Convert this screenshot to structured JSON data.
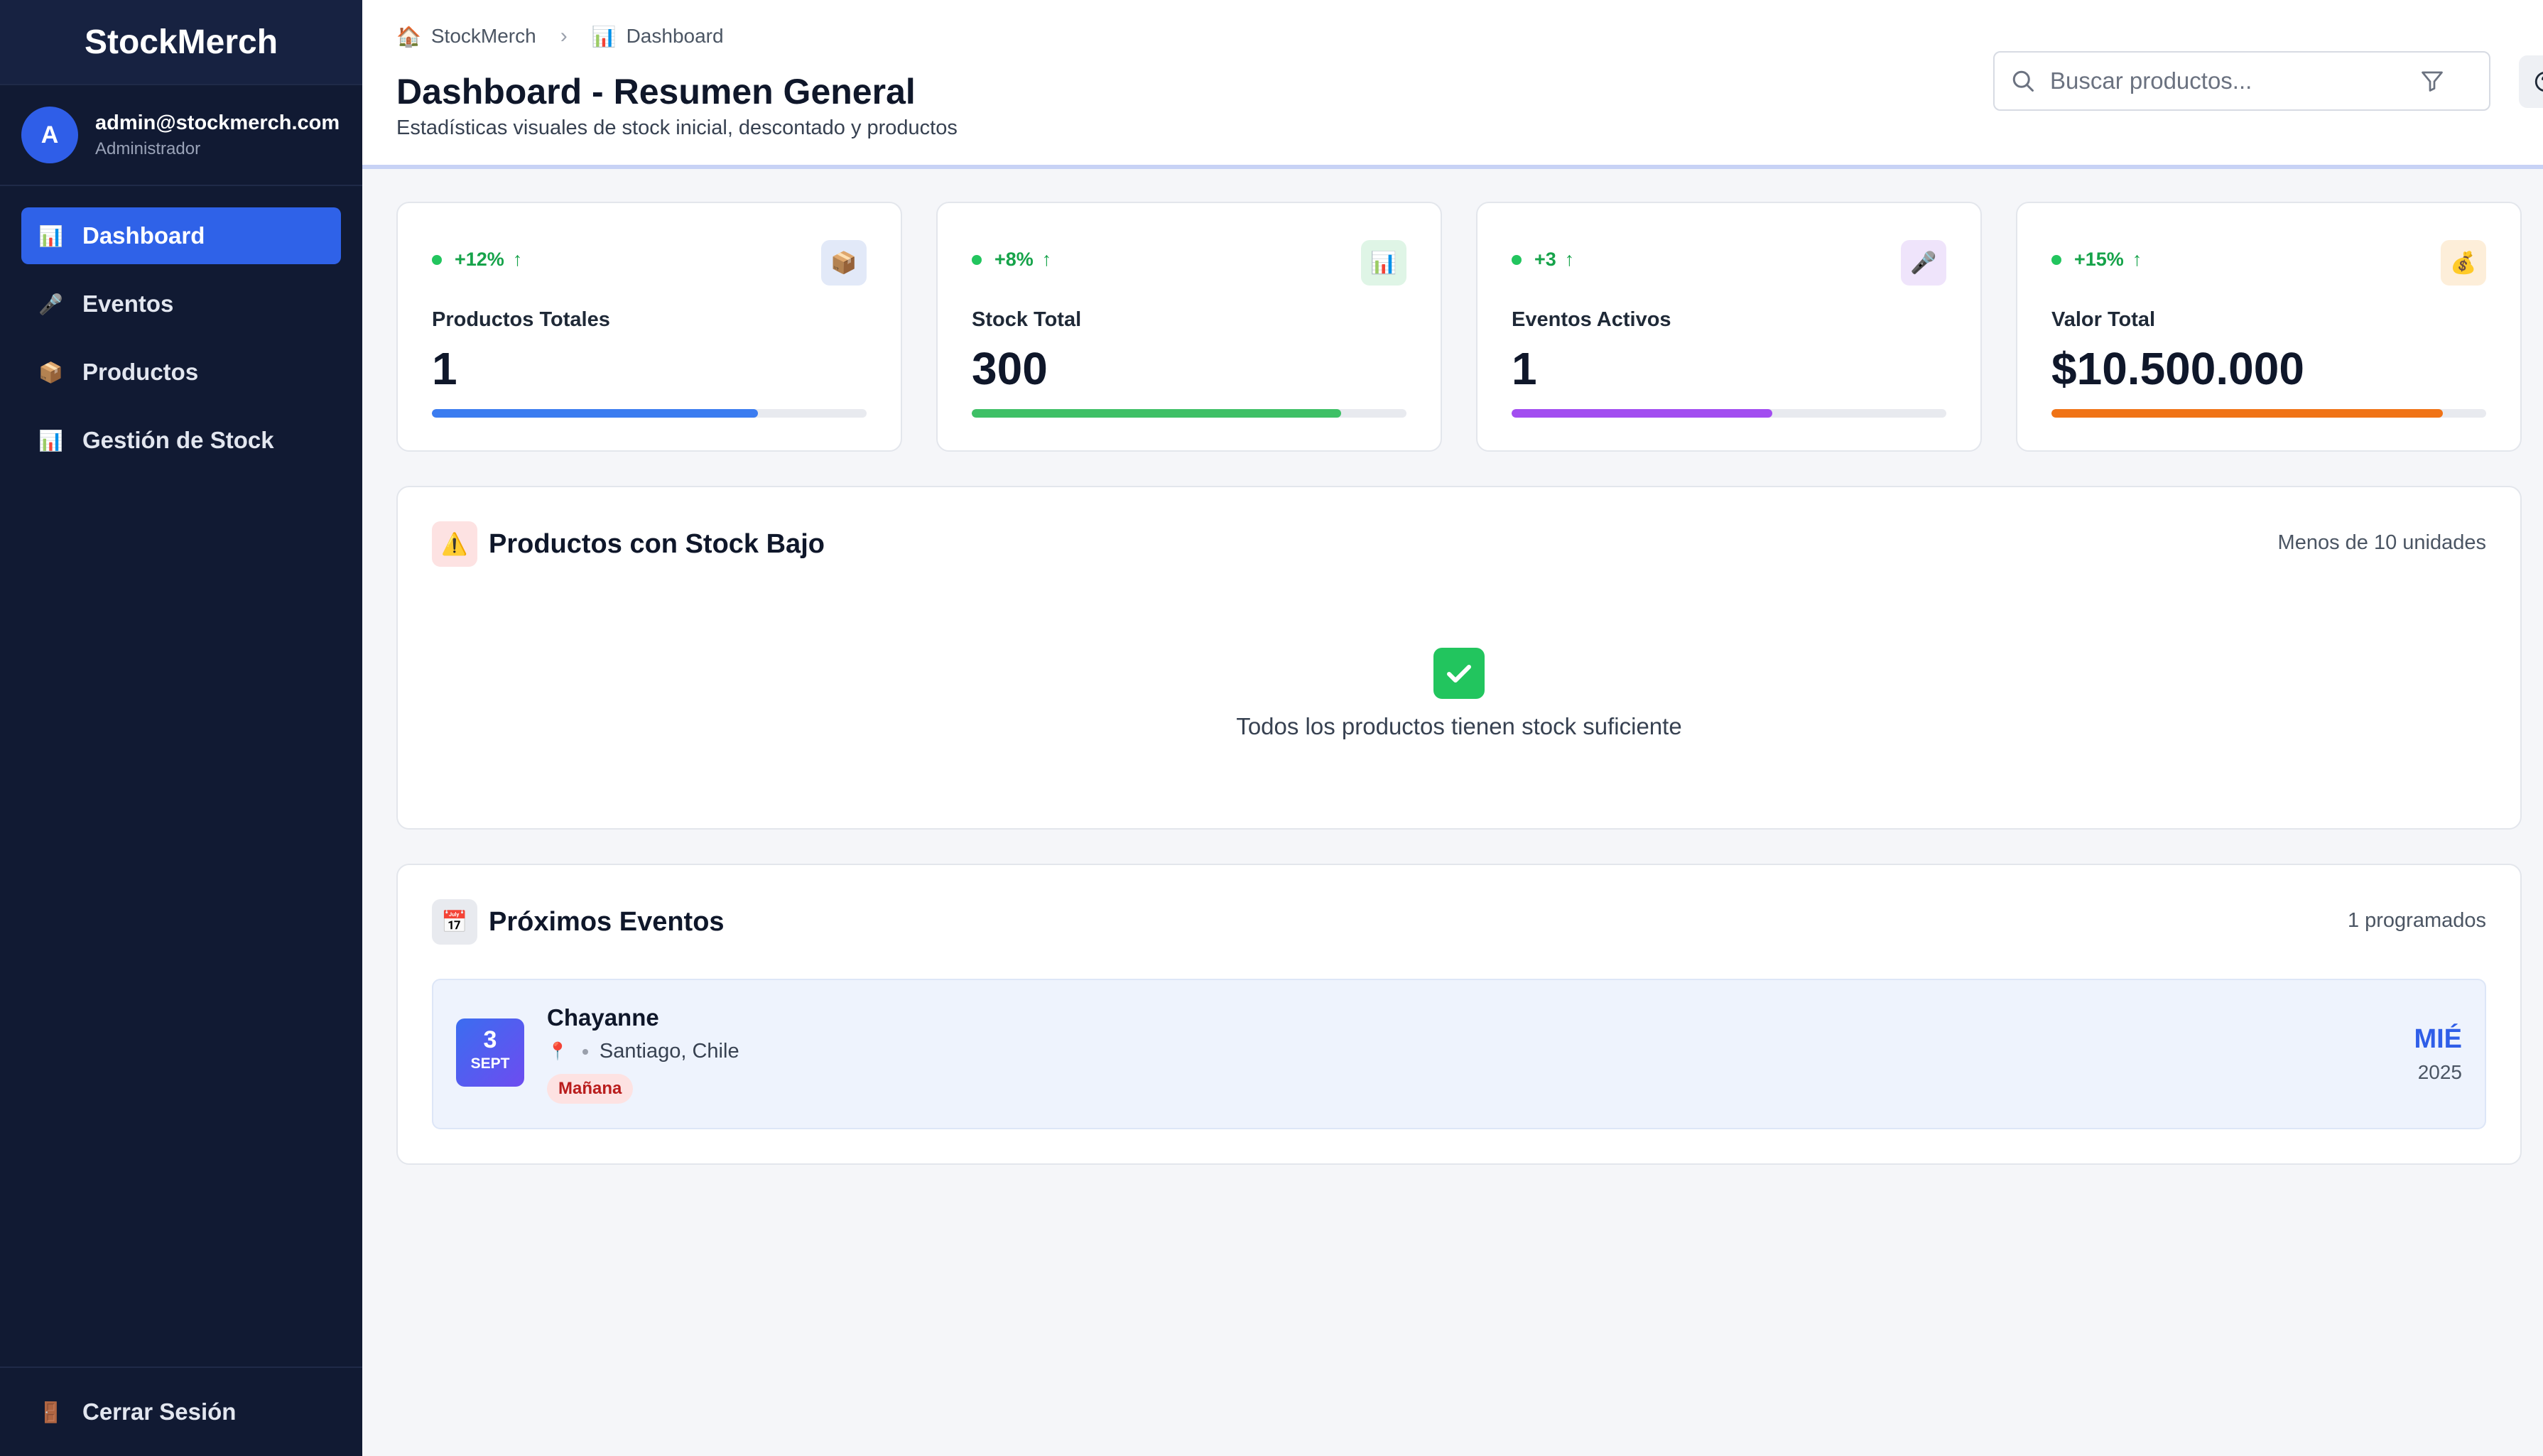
{
  "sidebar": {
    "brand": "StockMerch",
    "user": {
      "initial": "A",
      "email": "admin@stockmerch.com",
      "role": "Administrador"
    },
    "items": [
      {
        "label": "Dashboard",
        "icon": "bar-chart-icon"
      },
      {
        "label": "Eventos",
        "icon": "microphone-icon"
      },
      {
        "label": "Productos",
        "icon": "package-icon"
      },
      {
        "label": "Gestión de Stock",
        "icon": "bar-chart-icon"
      }
    ],
    "logout": "Cerrar Sesión"
  },
  "header": {
    "breadcrumb": [
      "StockMerch",
      "Dashboard"
    ],
    "title": "Dashboard - Resumen General",
    "subtitle": "Estadísticas visuales de stock inicial, descontado y productos",
    "search_placeholder": "Buscar productos..."
  },
  "stats": [
    {
      "trend": "+12%",
      "label": "Productos Totales",
      "value": "1",
      "progress": 0.75,
      "color": "#3b7cf0",
      "icon": "package-icon",
      "icon_bg": "#e2e9f8"
    },
    {
      "trend": "+8%",
      "label": "Stock Total",
      "value": "300",
      "progress": 0.85,
      "color": "#3ec066",
      "icon": "bar-chart-icon",
      "icon_bg": "#dff5e6"
    },
    {
      "trend": "+3",
      "label": "Eventos Activos",
      "value": "1",
      "progress": 0.6,
      "color": "#a24df0",
      "icon": "microphone-icon",
      "icon_bg": "#efe4fb"
    },
    {
      "trend": "+15%",
      "label": "Valor Total",
      "value": "$10.500.000",
      "progress": 0.9,
      "color": "#f07316",
      "icon": "money-bag-icon",
      "icon_bg": "#fdeed9"
    }
  ],
  "low_stock": {
    "title": "Productos con Stock Bajo",
    "meta": "Menos de 10 unidades",
    "empty_message": "Todos los productos tienen stock suficiente"
  },
  "events": {
    "title": "Próximos Eventos",
    "meta": "1 programados",
    "items": [
      {
        "day": "3",
        "month": "SEPT",
        "name": "Chayanne",
        "location": "Santiago, Chile",
        "tag": "Mañana",
        "weekday": "MIÉ",
        "year": "2025"
      }
    ]
  },
  "colors": {
    "sidebar_bg": "#111a33",
    "accent": "#2f62e8",
    "success": "#22c55e"
  }
}
